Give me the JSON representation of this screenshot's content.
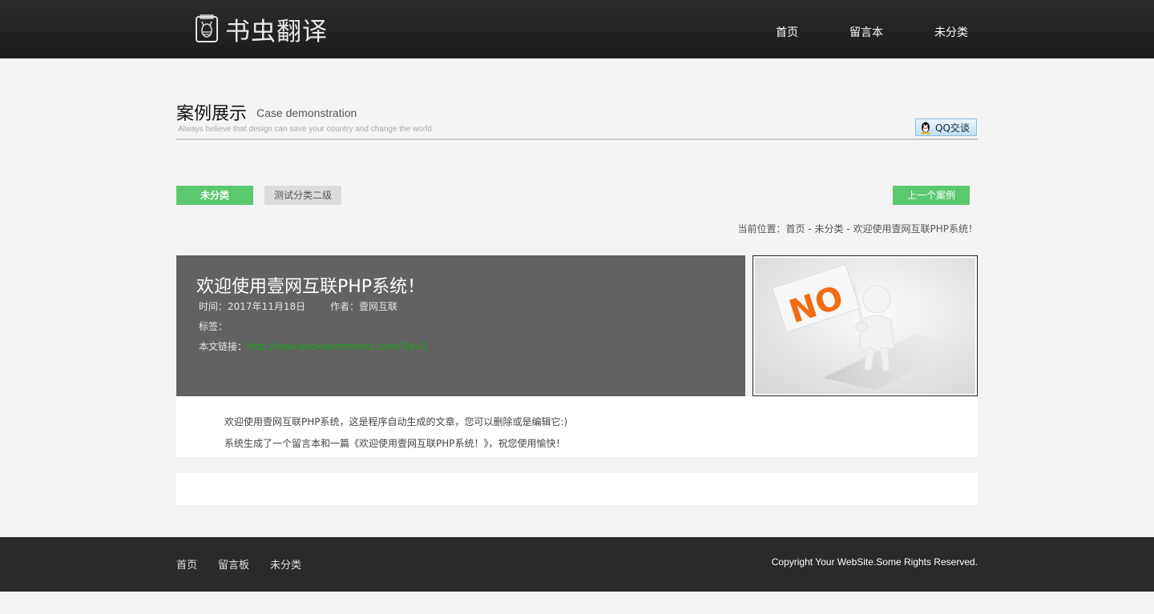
{
  "header": {
    "logo_text": "书虫翻译",
    "logo_icon": "bookworm-logo-icon",
    "nav": [
      {
        "label": "首页"
      },
      {
        "label": "留言本"
      },
      {
        "label": "未分类"
      }
    ]
  },
  "section": {
    "title": "案例展示",
    "subtitle_en": "Case demonstration",
    "slogan": "Always believe that design can save your country and change the world",
    "qq_label": "QQ交谈",
    "qq_icon": "qq-penguin-icon"
  },
  "categories": {
    "active": "未分类",
    "normal": "测试分类二级",
    "prev_label": "上一个案例",
    "accent_color": "#5ac86e"
  },
  "breadcrumb": {
    "prefix": "当前位置：",
    "home": "首页",
    "sep1": " - ",
    "category": "未分类",
    "sep2": " - ",
    "current": "欢迎使用壹网互联PHP系统！"
  },
  "post": {
    "title": "欢迎使用壹网互联PHP系统！",
    "time_label": "时间：",
    "time": "2017年11月18日",
    "author_label": "作者：",
    "author": "壹网互联",
    "tags_label": "标签：",
    "link_label": "本文链接：",
    "link": "http://new.bookwormtrans.com/?id=1",
    "thumb_text": "NO",
    "body": [
      "欢迎使用壹网互联PHP系统，这是程序自动生成的文章，您可以删除或是编辑它:)",
      "系统生成了一个留言本和一篇《欢迎使用壹网互联PHP系统！》，祝您使用愉快！"
    ]
  },
  "footer": {
    "nav": [
      {
        "label": "首页"
      },
      {
        "label": "留言板"
      },
      {
        "label": "未分类"
      }
    ],
    "copyright": "Copyright Your WebSite.Some Rights Reserved."
  }
}
